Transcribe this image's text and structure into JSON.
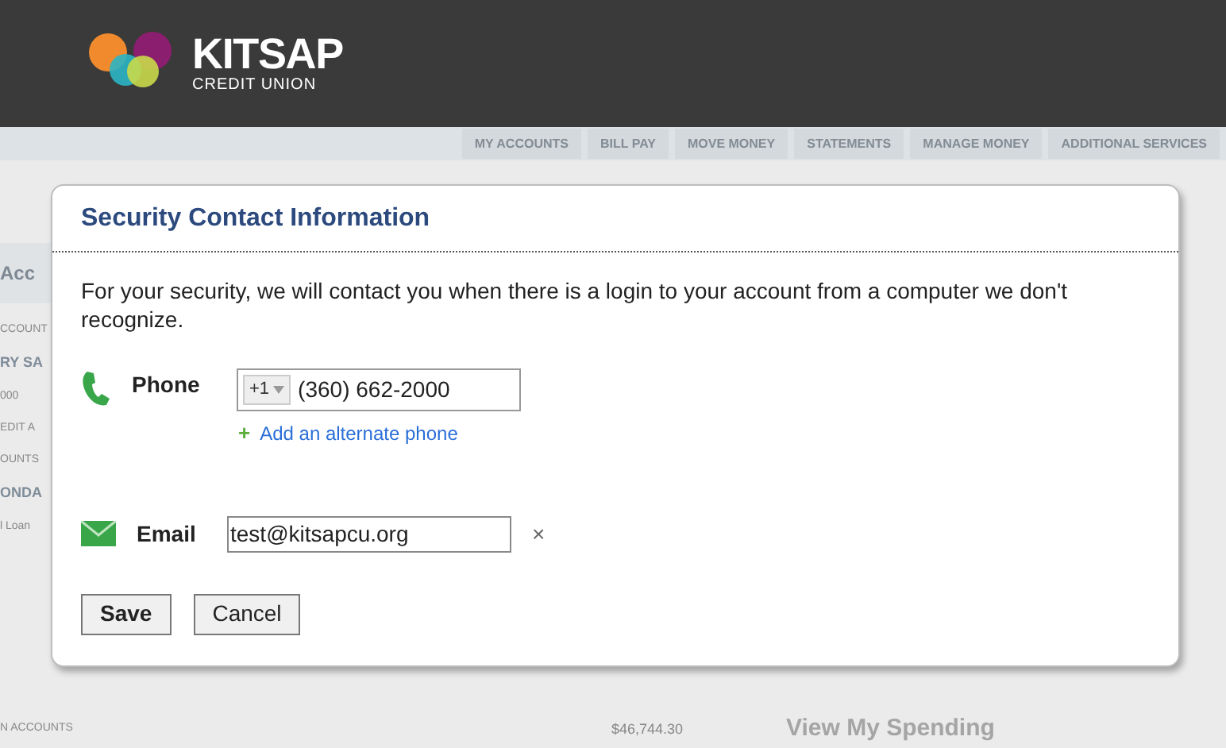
{
  "header": {
    "logo_text": "KITSAP",
    "logo_subtext": "CREDIT UNION"
  },
  "nav": [
    "MY ACCOUNTS",
    "BILL PAY",
    "MOVE MONEY",
    "STATEMENTS",
    "MANAGE MONEY",
    "ADDITIONAL SERVICES"
  ],
  "background": {
    "left_fragments": [
      {
        "kind": "heading",
        "text": "Acc"
      },
      {
        "kind": "label",
        "text": "CCOUNT"
      },
      {
        "kind": "name",
        "text": "RY SA"
      },
      {
        "kind": "label",
        "text": "000"
      },
      {
        "kind": "label",
        "text": "EDIT A"
      },
      {
        "kind": "label",
        "text": "OUNTS"
      },
      {
        "kind": "name",
        "text": "ONDA"
      },
      {
        "kind": "label",
        "text": "l Loan"
      }
    ],
    "section_label": "N ACCOUNTS",
    "balance": "$46,744.30",
    "spending_link": "View My Spending"
  },
  "dialog": {
    "title": "Security Contact Information",
    "message": "For your security, we will contact you when there is a login to your account from a computer we don't recognize.",
    "phone": {
      "label": "Phone",
      "country_code": "+1",
      "value": "(360) 662-2000",
      "add_icon": "+",
      "add_link": "Add an alternate phone"
    },
    "email": {
      "label": "Email",
      "value": "test@kitsapcu.org",
      "clear": "×"
    },
    "buttons": [
      {
        "label": "Save",
        "primary": true
      },
      {
        "label": "Cancel",
        "primary": false
      }
    ]
  }
}
